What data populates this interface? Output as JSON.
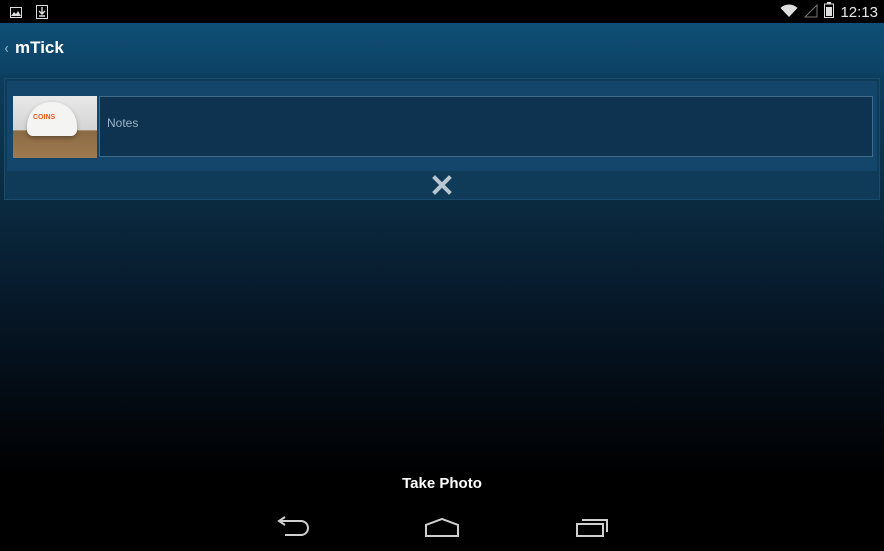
{
  "status": {
    "time": "12:13"
  },
  "app": {
    "title": "mTick",
    "up_indicator": "‹"
  },
  "card": {
    "notes_placeholder": "Notes",
    "photo_logo_text": "COINS"
  },
  "actions": {
    "take_photo_label": "Take Photo"
  },
  "icons": {
    "gallery": "image-notification-icon",
    "download": "download-notification-icon",
    "wifi": "wifi-icon",
    "signal": "signal-icon",
    "battery": "battery-icon",
    "remove": "close-icon",
    "back": "back-icon",
    "home": "home-icon",
    "recents": "recents-icon"
  }
}
